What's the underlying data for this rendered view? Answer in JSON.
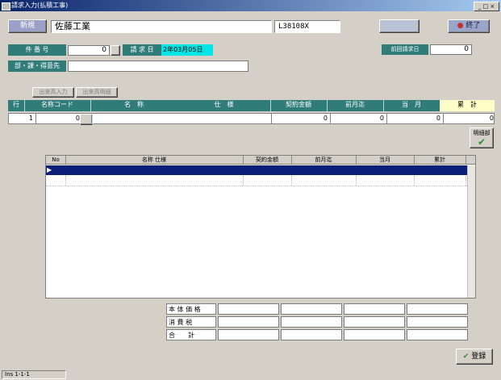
{
  "window": {
    "title": "請求入力(払積工事)",
    "controls": "_ □ ×"
  },
  "header": {
    "new_button": "新規",
    "name_value": "佐藤工業",
    "code_value": "L38108X",
    "blank_button": "",
    "exit_button": "終了"
  },
  "fields": {
    "project_no_label": "件 番 号",
    "project_no_value": "0",
    "billing_label": "請 求 日",
    "billing_value": "2年03月05日",
    "department_label": "部・課・得意先",
    "department_value": "",
    "previous_label": "前回請求日",
    "previous_value": "0"
  },
  "tabs": {
    "tab1": "出来高入力",
    "tab2": "出来高明細"
  },
  "detail_table": {
    "headers": [
      "行",
      "名称コード",
      "名　称",
      "仕　様",
      "契約金額",
      "前月迄",
      "当　月",
      "累　計"
    ],
    "row": {
      "line": "1",
      "code": "0",
      "name": "",
      "spec": "",
      "contract": "0",
      "prev": "0",
      "current": "0",
      "total": "0"
    }
  },
  "detail_button": {
    "label": "明細部"
  },
  "grid": {
    "headers": [
      "No",
      "名称 仕様",
      "契約金額",
      "前月迄",
      "当月",
      "累計"
    ],
    "rows": [
      "",
      "",
      ""
    ]
  },
  "totals": {
    "rows": [
      {
        "label": "本 体 価 格",
        "values": [
          "",
          "",
          "",
          ""
        ]
      },
      {
        "label": "消 費 税",
        "values": [
          "",
          "",
          "",
          ""
        ]
      },
      {
        "label": "合　　計",
        "values": [
          "",
          "",
          "",
          ""
        ]
      }
    ]
  },
  "footer": {
    "register_button": "登録"
  },
  "status": {
    "text": "Ins  1-1-1"
  }
}
